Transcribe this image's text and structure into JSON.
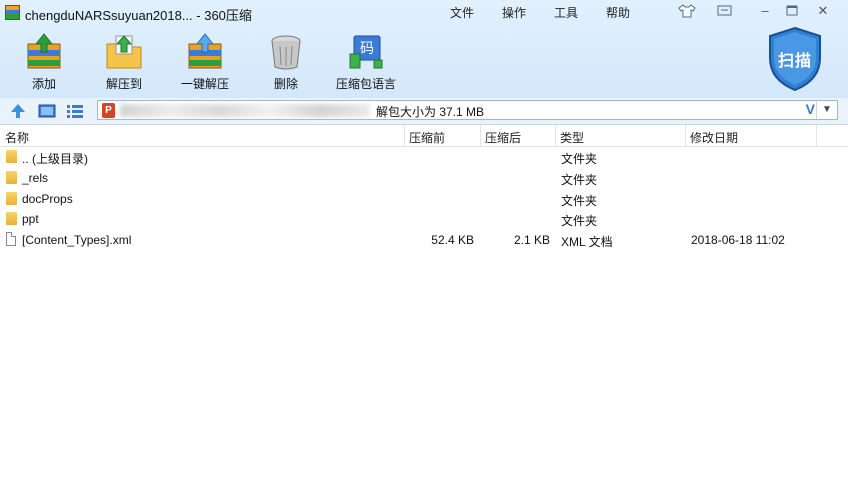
{
  "window": {
    "title": "chengduNARSsuyuan2018... - 360压缩"
  },
  "menu": [
    "文件",
    "操作",
    "工具",
    "帮助"
  ],
  "toolbar": [
    {
      "label": "添加",
      "icon": "add-archive-icon"
    },
    {
      "label": "解压到",
      "icon": "extract-to-icon"
    },
    {
      "label": "一键解压",
      "icon": "one-click-extract-icon"
    },
    {
      "label": "删除",
      "icon": "delete-bin-icon"
    },
    {
      "label": "压缩包语言",
      "icon": "archive-language-icon"
    }
  ],
  "scan": {
    "label": "扫描",
    "icon": "shield-scan-icon"
  },
  "address": {
    "info": "解包大小为 37.1 MB",
    "file_icon": "powerpoint-file-icon"
  },
  "columns": {
    "name": "名称",
    "packed": "压缩前",
    "compressed": "压缩后",
    "type": "类型",
    "modified": "修改日期"
  },
  "rows": [
    {
      "name": ".. (上级目录)",
      "packed": "",
      "compressed": "",
      "type": "文件夹",
      "modified": "",
      "kind": "folder"
    },
    {
      "name": "_rels",
      "packed": "",
      "compressed": "",
      "type": "文件夹",
      "modified": "",
      "kind": "folder"
    },
    {
      "name": "docProps",
      "packed": "",
      "compressed": "",
      "type": "文件夹",
      "modified": "",
      "kind": "folder"
    },
    {
      "name": "ppt",
      "packed": "",
      "compressed": "",
      "type": "文件夹",
      "modified": "",
      "kind": "folder"
    },
    {
      "name": "[Content_Types].xml",
      "packed": "52.4 KB",
      "compressed": "2.1 KB",
      "type": "XML 文档",
      "modified": "2018-06-18 11:02",
      "kind": "file"
    }
  ]
}
